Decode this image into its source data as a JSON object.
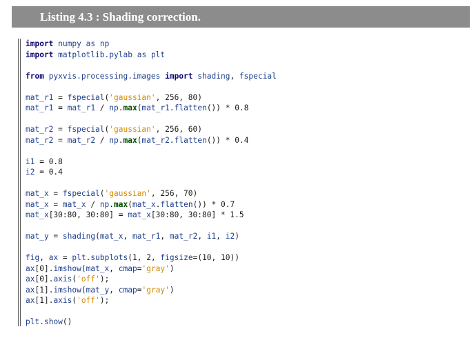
{
  "listing": {
    "title": "Listing 4.3 :  Shading correction."
  },
  "code_lines": [
    [
      {
        "t": "kw",
        "v": "import"
      },
      {
        "t": "plain",
        "v": " "
      },
      {
        "t": "id",
        "v": "numpy"
      },
      {
        "t": "plain",
        "v": " "
      },
      {
        "t": "id",
        "v": "as"
      },
      {
        "t": "plain",
        "v": " "
      },
      {
        "t": "id",
        "v": "np"
      }
    ],
    [
      {
        "t": "kw",
        "v": "import"
      },
      {
        "t": "plain",
        "v": " "
      },
      {
        "t": "id",
        "v": "matplotlib.pylab"
      },
      {
        "t": "plain",
        "v": " "
      },
      {
        "t": "id",
        "v": "as"
      },
      {
        "t": "plain",
        "v": " "
      },
      {
        "t": "id",
        "v": "plt"
      }
    ],
    [],
    [
      {
        "t": "kw",
        "v": "from"
      },
      {
        "t": "plain",
        "v": " "
      },
      {
        "t": "id",
        "v": "pyxvis.processing.images"
      },
      {
        "t": "plain",
        "v": " "
      },
      {
        "t": "kw",
        "v": "import"
      },
      {
        "t": "plain",
        "v": " "
      },
      {
        "t": "id",
        "v": "shading"
      },
      {
        "t": "plain",
        "v": ", "
      },
      {
        "t": "id",
        "v": "fspecial"
      }
    ],
    [],
    [
      {
        "t": "id",
        "v": "mat_r1"
      },
      {
        "t": "plain",
        "v": " = "
      },
      {
        "t": "id",
        "v": "fspecial"
      },
      {
        "t": "plain",
        "v": "("
      },
      {
        "t": "str",
        "v": "'gaussian'"
      },
      {
        "t": "plain",
        "v": ", 256, 80)"
      }
    ],
    [
      {
        "t": "id",
        "v": "mat_r1"
      },
      {
        "t": "plain",
        "v": " = "
      },
      {
        "t": "id",
        "v": "mat_r1"
      },
      {
        "t": "plain",
        "v": " / "
      },
      {
        "t": "id",
        "v": "np"
      },
      {
        "t": "plain",
        "v": "."
      },
      {
        "t": "bi",
        "v": "max"
      },
      {
        "t": "plain",
        "v": "("
      },
      {
        "t": "id",
        "v": "mat_r1"
      },
      {
        "t": "plain",
        "v": "."
      },
      {
        "t": "id",
        "v": "flatten"
      },
      {
        "t": "plain",
        "v": "()) * 0.8"
      }
    ],
    [],
    [
      {
        "t": "id",
        "v": "mat_r2"
      },
      {
        "t": "plain",
        "v": " = "
      },
      {
        "t": "id",
        "v": "fspecial"
      },
      {
        "t": "plain",
        "v": "("
      },
      {
        "t": "str",
        "v": "'gaussian'"
      },
      {
        "t": "plain",
        "v": ", 256, 60)"
      }
    ],
    [
      {
        "t": "id",
        "v": "mat_r2"
      },
      {
        "t": "plain",
        "v": " = "
      },
      {
        "t": "id",
        "v": "mat_r2"
      },
      {
        "t": "plain",
        "v": " / "
      },
      {
        "t": "id",
        "v": "np"
      },
      {
        "t": "plain",
        "v": "."
      },
      {
        "t": "bi",
        "v": "max"
      },
      {
        "t": "plain",
        "v": "("
      },
      {
        "t": "id",
        "v": "mat_r2"
      },
      {
        "t": "plain",
        "v": "."
      },
      {
        "t": "id",
        "v": "flatten"
      },
      {
        "t": "plain",
        "v": "()) * 0.4"
      }
    ],
    [],
    [
      {
        "t": "id",
        "v": "i1"
      },
      {
        "t": "plain",
        "v": " = 0.8"
      }
    ],
    [
      {
        "t": "id",
        "v": "i2"
      },
      {
        "t": "plain",
        "v": " = 0.4"
      }
    ],
    [],
    [
      {
        "t": "id",
        "v": "mat_x"
      },
      {
        "t": "plain",
        "v": " = "
      },
      {
        "t": "id",
        "v": "fspecial"
      },
      {
        "t": "plain",
        "v": "("
      },
      {
        "t": "str",
        "v": "'gaussian'"
      },
      {
        "t": "plain",
        "v": ", 256, 70)"
      }
    ],
    [
      {
        "t": "id",
        "v": "mat_x"
      },
      {
        "t": "plain",
        "v": " = "
      },
      {
        "t": "id",
        "v": "mat_x"
      },
      {
        "t": "plain",
        "v": " / "
      },
      {
        "t": "id",
        "v": "np"
      },
      {
        "t": "plain",
        "v": "."
      },
      {
        "t": "bi",
        "v": "max"
      },
      {
        "t": "plain",
        "v": "("
      },
      {
        "t": "id",
        "v": "mat_x"
      },
      {
        "t": "plain",
        "v": "."
      },
      {
        "t": "id",
        "v": "flatten"
      },
      {
        "t": "plain",
        "v": "()) * 0.7"
      }
    ],
    [
      {
        "t": "id",
        "v": "mat_x"
      },
      {
        "t": "plain",
        "v": "[30:80, 30:80] = "
      },
      {
        "t": "id",
        "v": "mat_x"
      },
      {
        "t": "plain",
        "v": "[30:80, 30:80] * 1.5"
      }
    ],
    [],
    [
      {
        "t": "id",
        "v": "mat_y"
      },
      {
        "t": "plain",
        "v": " = "
      },
      {
        "t": "id",
        "v": "shading"
      },
      {
        "t": "plain",
        "v": "("
      },
      {
        "t": "id",
        "v": "mat_x"
      },
      {
        "t": "plain",
        "v": ", "
      },
      {
        "t": "id",
        "v": "mat_r1"
      },
      {
        "t": "plain",
        "v": ", "
      },
      {
        "t": "id",
        "v": "mat_r2"
      },
      {
        "t": "plain",
        "v": ", "
      },
      {
        "t": "id",
        "v": "i1"
      },
      {
        "t": "plain",
        "v": ", "
      },
      {
        "t": "id",
        "v": "i2"
      },
      {
        "t": "plain",
        "v": ")"
      }
    ],
    [],
    [
      {
        "t": "id",
        "v": "fig"
      },
      {
        "t": "plain",
        "v": ", "
      },
      {
        "t": "id",
        "v": "ax"
      },
      {
        "t": "plain",
        "v": " = "
      },
      {
        "t": "id",
        "v": "plt"
      },
      {
        "t": "plain",
        "v": "."
      },
      {
        "t": "id",
        "v": "subplots"
      },
      {
        "t": "plain",
        "v": "(1, 2, "
      },
      {
        "t": "id",
        "v": "figsize"
      },
      {
        "t": "plain",
        "v": "=(10, 10))"
      }
    ],
    [
      {
        "t": "id",
        "v": "ax"
      },
      {
        "t": "plain",
        "v": "[0]."
      },
      {
        "t": "id",
        "v": "imshow"
      },
      {
        "t": "plain",
        "v": "("
      },
      {
        "t": "id",
        "v": "mat_x"
      },
      {
        "t": "plain",
        "v": ", "
      },
      {
        "t": "id",
        "v": "cmap"
      },
      {
        "t": "plain",
        "v": "="
      },
      {
        "t": "str",
        "v": "'gray'"
      },
      {
        "t": "plain",
        "v": ")"
      }
    ],
    [
      {
        "t": "id",
        "v": "ax"
      },
      {
        "t": "plain",
        "v": "[0]."
      },
      {
        "t": "id",
        "v": "axis"
      },
      {
        "t": "plain",
        "v": "("
      },
      {
        "t": "str",
        "v": "'off'"
      },
      {
        "t": "plain",
        "v": ");"
      }
    ],
    [
      {
        "t": "id",
        "v": "ax"
      },
      {
        "t": "plain",
        "v": "[1]."
      },
      {
        "t": "id",
        "v": "imshow"
      },
      {
        "t": "plain",
        "v": "("
      },
      {
        "t": "id",
        "v": "mat_y"
      },
      {
        "t": "plain",
        "v": ", "
      },
      {
        "t": "id",
        "v": "cmap"
      },
      {
        "t": "plain",
        "v": "="
      },
      {
        "t": "str",
        "v": "'gray'"
      },
      {
        "t": "plain",
        "v": ")"
      }
    ],
    [
      {
        "t": "id",
        "v": "ax"
      },
      {
        "t": "plain",
        "v": "[1]."
      },
      {
        "t": "id",
        "v": "axis"
      },
      {
        "t": "plain",
        "v": "("
      },
      {
        "t": "str",
        "v": "'off'"
      },
      {
        "t": "plain",
        "v": ");"
      }
    ],
    [],
    [
      {
        "t": "id",
        "v": "plt"
      },
      {
        "t": "plain",
        "v": "."
      },
      {
        "t": "id",
        "v": "show"
      },
      {
        "t": "plain",
        "v": "()"
      }
    ]
  ]
}
